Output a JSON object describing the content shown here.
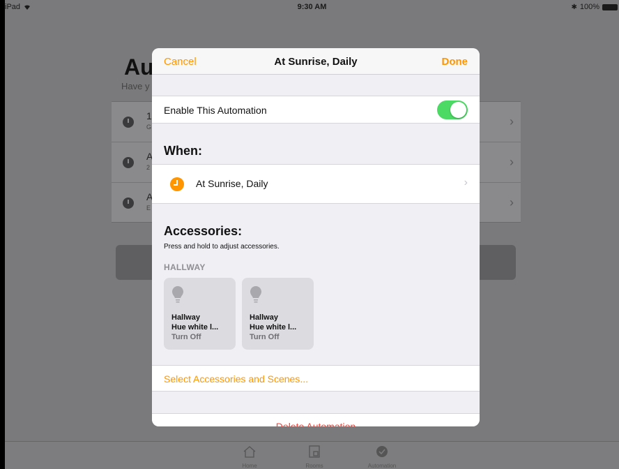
{
  "status_bar": {
    "device": "iPad",
    "time": "9:30 AM",
    "battery": "100%"
  },
  "background": {
    "title": "Au",
    "subtitle": "Have y",
    "rows": [
      {
        "t1": "1",
        "t2": "G"
      },
      {
        "t1": "A",
        "t2": "2"
      },
      {
        "t1": "A",
        "t2": "E"
      }
    ]
  },
  "modal": {
    "cancel_label": "Cancel",
    "title": "At Sunrise, Daily",
    "done_label": "Done",
    "enable_label": "Enable This Automation",
    "enable_on": true,
    "when_header": "When:",
    "when_value": "At Sunrise, Daily",
    "accessories_header": "Accessories:",
    "accessories_hint": "Press and hold to adjust accessories.",
    "room_label": "HALLWAY",
    "tiles": [
      {
        "line1": "Hallway",
        "line2": "Hue white l...",
        "state": "Turn Off"
      },
      {
        "line1": "Hallway",
        "line2": "Hue white l...",
        "state": "Turn Off"
      }
    ],
    "select_label": "Select Accessories and Scenes...",
    "delete_label": "Delete Automation"
  },
  "tab_bar": {
    "tabs": [
      "Home",
      "Rooms",
      "Automation"
    ]
  },
  "colors": {
    "accent": "#ff9500",
    "toggle_on": "#4cd964",
    "destructive": "#ff3b30"
  }
}
